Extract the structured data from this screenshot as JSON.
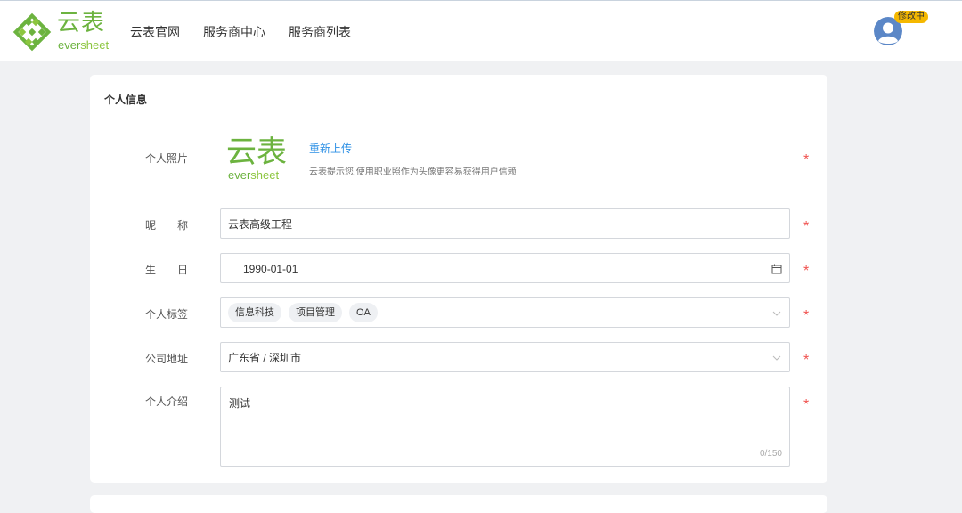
{
  "header": {
    "logo": {
      "cn": "云表",
      "en_a": "ever",
      "en_b": "sheet"
    },
    "nav": [
      {
        "label": "云表官网"
      },
      {
        "label": "服务商中心"
      },
      {
        "label": "服务商列表"
      }
    ],
    "badge": "修改中"
  },
  "card": {
    "title": "个人信息",
    "photo": {
      "label": "个人照片",
      "logo_cn": "云表",
      "logo_en_a": "ever",
      "logo_en_b": "sheet",
      "upload": "重新上传",
      "hint": "云表提示您,使用职业照作为头像更容易获得用户信赖"
    },
    "nickname": {
      "label": "昵　　称",
      "value": "云表高级工程"
    },
    "birthday": {
      "label": "生　　日",
      "value": "1990-01-01"
    },
    "tags": {
      "label": "个人标签",
      "items": [
        "信息科技",
        "项目管理",
        "OA"
      ]
    },
    "address": {
      "label": "公司地址",
      "value": "广东省 / 深圳市"
    },
    "intro": {
      "label": "个人介绍",
      "value": "测试",
      "count": "0/150"
    },
    "required_mark": "*"
  },
  "colors": {
    "brand_green": "#6cb33f",
    "link_blue": "#2b8fe5",
    "required_red": "#f0524f",
    "badge_yellow": "#f5b800"
  }
}
